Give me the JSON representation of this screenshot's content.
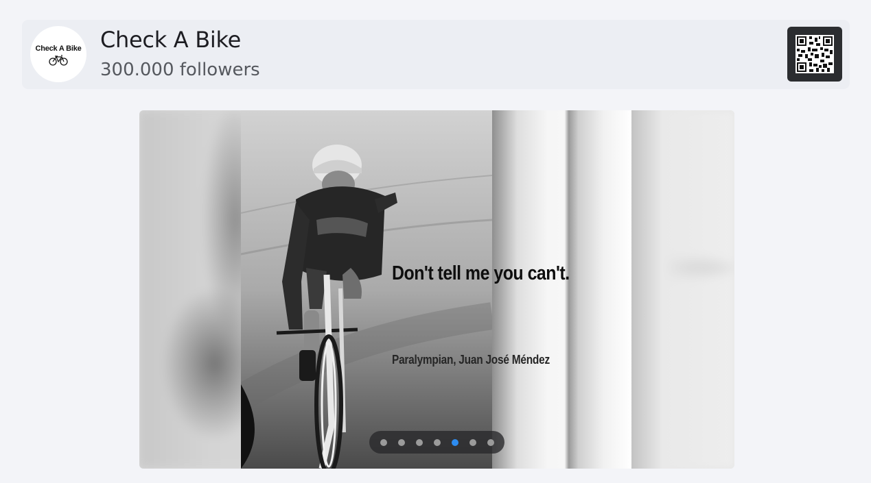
{
  "header": {
    "avatar_label": "Check A Bike",
    "title": "Check A Bike",
    "followers": "300.000 followers",
    "qr_icon": "qr-code-icon"
  },
  "carousel": {
    "quote": "Don't tell me you can't.",
    "attribution": "Paralympian, Juan José Méndez",
    "slide_count": 7,
    "active_index": 4,
    "active_color": "#2d8cf0",
    "inactive_color": "#9b9b9b"
  }
}
